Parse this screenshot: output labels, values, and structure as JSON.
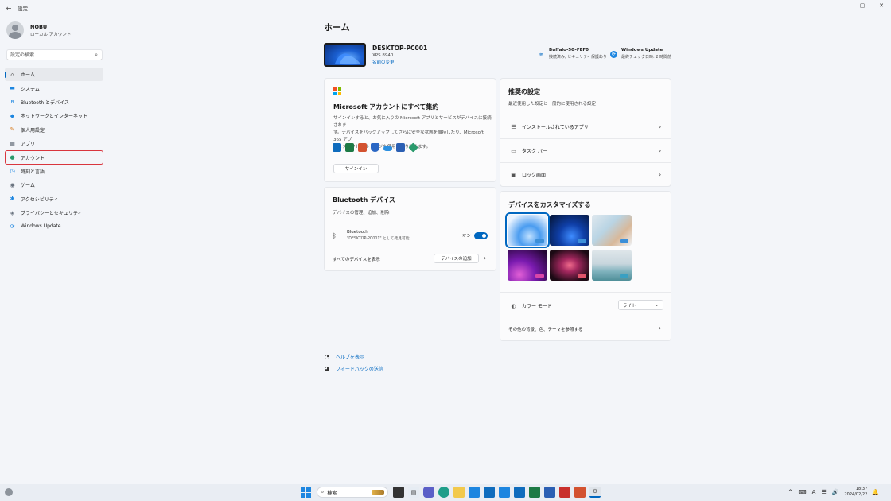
{
  "window": {
    "title": "設定",
    "back": "←",
    "controls": [
      "—",
      "▢",
      "✕"
    ]
  },
  "profile": {
    "name": "NOBU",
    "account_type": "ローカル アカウント"
  },
  "search": {
    "placeholder": "設定の検索"
  },
  "nav": [
    {
      "label": "ホーム",
      "icon": "home-icon",
      "glyph": "⌂",
      "color": "#555"
    },
    {
      "label": "システム",
      "icon": "system-icon",
      "glyph": "▬",
      "color": "#1d86e0"
    },
    {
      "label": "Bluetooth とデバイス",
      "icon": "bluetooth-icon",
      "glyph": "ʙ",
      "color": "#1d86e0"
    },
    {
      "label": "ネットワークとインターネット",
      "icon": "network-icon",
      "glyph": "◆",
      "color": "#1d86e0"
    },
    {
      "label": "個人用設定",
      "icon": "personalization-icon",
      "glyph": "✎",
      "color": "#d9822b"
    },
    {
      "label": "アプリ",
      "icon": "apps-icon",
      "glyph": "▦",
      "color": "#5a6470"
    },
    {
      "label": "アカウント",
      "icon": "accounts-icon",
      "glyph": "●",
      "color": "#2a9a6c"
    },
    {
      "label": "時刻と言語",
      "icon": "time-language-icon",
      "glyph": "◷",
      "color": "#1d86e0"
    },
    {
      "label": "ゲーム",
      "icon": "gaming-icon",
      "glyph": "◉",
      "color": "#6b7480"
    },
    {
      "label": "アクセシビリティ",
      "icon": "accessibility-icon",
      "glyph": "✱",
      "color": "#1d86e0"
    },
    {
      "label": "プライバシーとセキュリティ",
      "icon": "privacy-icon",
      "glyph": "◈",
      "color": "#6b7480"
    },
    {
      "label": "Windows Update",
      "icon": "windows-update-icon",
      "glyph": "⟳",
      "color": "#1d86e0"
    }
  ],
  "main": {
    "title": "ホーム",
    "device": {
      "name": "DESKTOP-PC001",
      "model": "XPS 8940",
      "rename": "名前の変更"
    },
    "wifi": {
      "title": "Buffalo-5G-FEF0",
      "sub": "接続済み, セキュリティ保護あり"
    },
    "update": {
      "title": "Windows Update",
      "sub": "最終チェック日時: 2 時間前"
    }
  },
  "ms_account": {
    "title": "Microsoft アカウントにすべて集約",
    "desc_line1": "サインインすると、お気に入りの Microsoft アプリとサービスがデバイスに接続されま",
    "desc_line2": "す。デバイスをバックアップしてさらに安全な状態を維持したり、Microsoft 365 アプ",
    "desc_line3": "リとクラウド ストレージを使用したりできます。",
    "button": "サインイン",
    "apps": [
      "outlook-icon",
      "excel-icon",
      "powerpoint-icon",
      "defender-icon",
      "onedrive-icon",
      "word-icon",
      "family-icon"
    ]
  },
  "bluetooth": {
    "title": "Bluetooth デバイス",
    "sub": "デバイスの管理、追加、削除",
    "label": "Bluetooth",
    "detail": "\"DESKTOP-PC001\" として発見可能",
    "state": "オン",
    "all_devices": "すべてのデバイスを表示",
    "add_button": "デバイスの追加"
  },
  "recommended": {
    "title": "推奨の設定",
    "sub": "最近使用した設定と一般的に使用される設定",
    "items": [
      "インストールされているアプリ",
      "タスク バー",
      "ロック画面"
    ]
  },
  "customize": {
    "title": "デバイスをカスタマイズする",
    "color_mode_label": "カラー モード",
    "color_mode_value": "ライト",
    "themes_link": "その他の背景、色、テーマを参照する"
  },
  "help": {
    "show_help": "ヘルプを表示",
    "feedback": "フィードバックの送信"
  },
  "taskbar": {
    "search": "検索",
    "time": "18:37",
    "date": "2024/02/22",
    "tray": [
      "^",
      "⌨",
      "A",
      "☰",
      "🔊"
    ]
  }
}
